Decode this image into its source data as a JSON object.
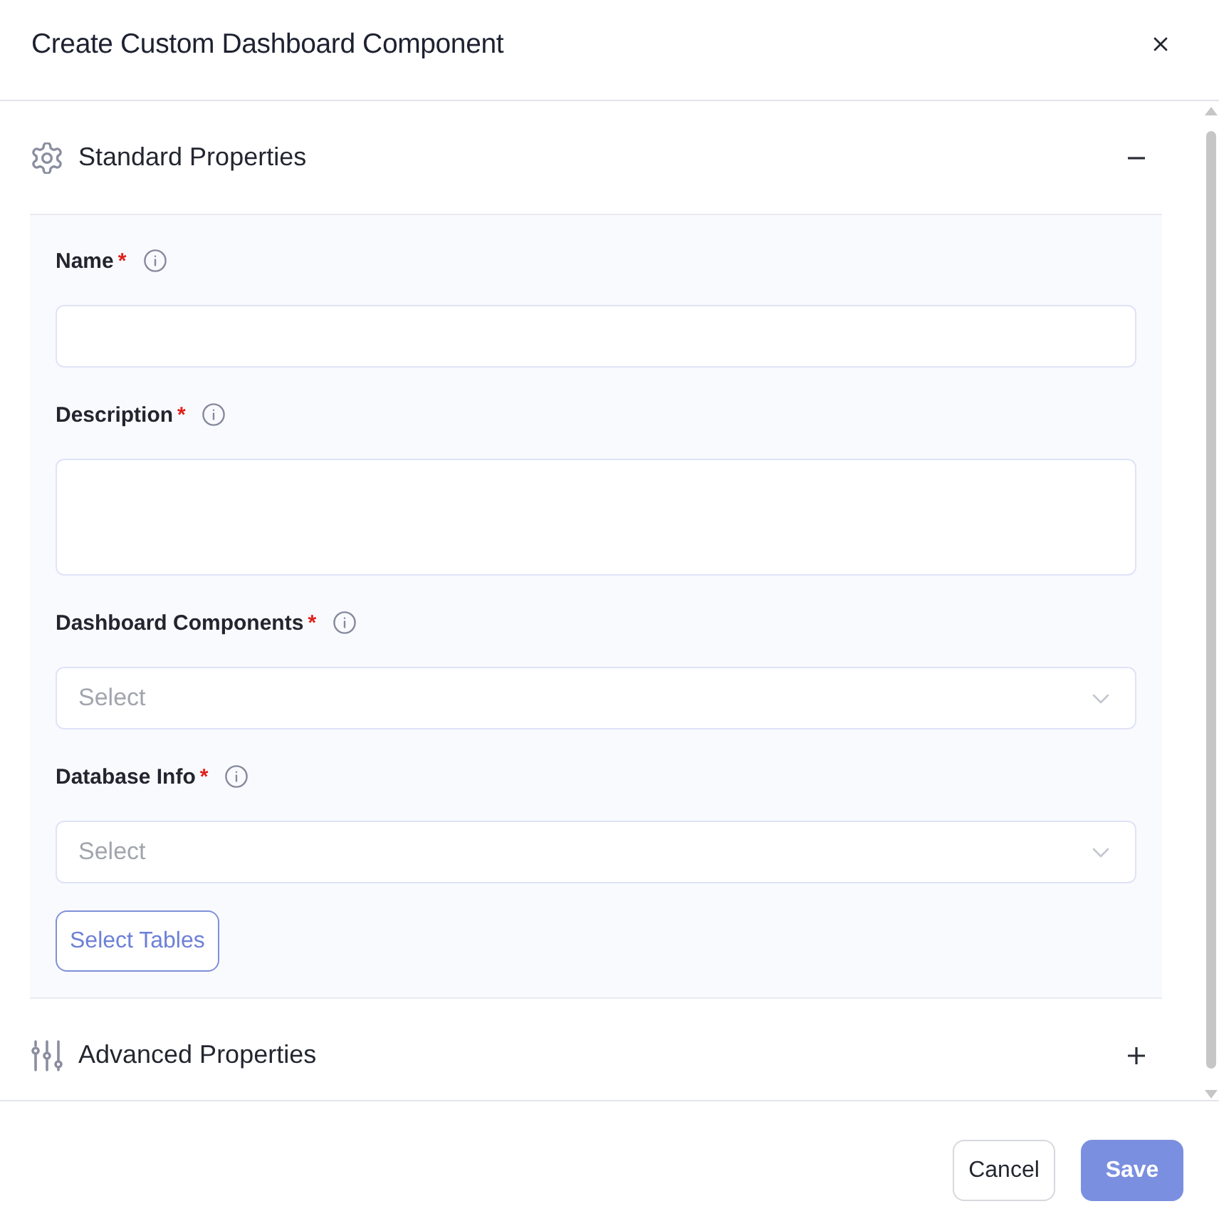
{
  "dialog": {
    "title": "Create Custom Dashboard Component"
  },
  "sections": [
    {
      "title": "Standard Properties",
      "kind": "standard",
      "expanded": true,
      "fields": [
        {
          "label": "Name",
          "required_mark": "*",
          "kind": "text"
        },
        {
          "label": "Description",
          "required_mark": "*",
          "kind": "textarea"
        },
        {
          "label": "Dashboard Components",
          "required_mark": "*",
          "kind": "select",
          "placeholder": "Select"
        },
        {
          "label": "Database Info",
          "required_mark": "*",
          "kind": "select",
          "placeholder": "Select"
        }
      ],
      "action": {
        "label": "Select Tables"
      }
    },
    {
      "title": "Advanced Properties",
      "kind": "advanced",
      "expanded": false
    }
  ],
  "footer": {
    "buttons": [
      {
        "label": "Cancel",
        "kind": "secondary"
      },
      {
        "label": "Save",
        "kind": "primary"
      }
    ]
  }
}
